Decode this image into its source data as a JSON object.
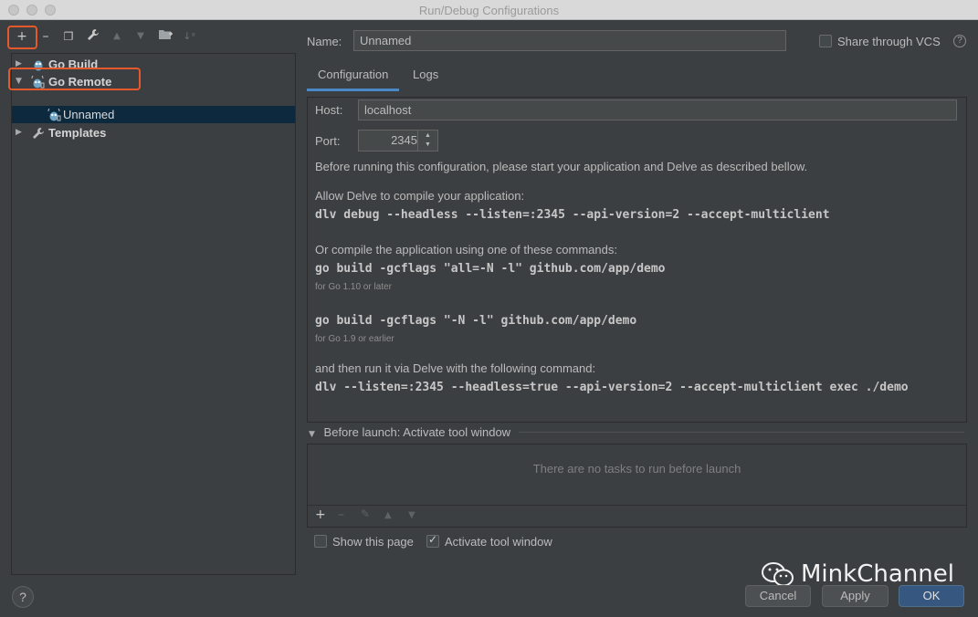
{
  "window": {
    "title": "Run/Debug Configurations"
  },
  "toolbar": {
    "icons": [
      "add-icon",
      "remove-icon",
      "copy-icon",
      "wrench-icon",
      "move-up-icon",
      "move-down-icon",
      "folder-add-icon",
      "sort-icon"
    ]
  },
  "tree": {
    "items": [
      {
        "label": "Go Build",
        "expanded": false,
        "icon": "gopher-icon"
      },
      {
        "label": "Go Remote",
        "expanded": true,
        "icon": "gopher-remote-icon"
      },
      {
        "label": "Unnamed",
        "selected": true,
        "icon": "gopher-remote-icon"
      },
      {
        "label": "Templates",
        "expanded": false,
        "icon": "wrench-icon"
      }
    ]
  },
  "name": {
    "label": "Name:",
    "value": "Unnamed"
  },
  "share": {
    "label": "Share through VCS",
    "checked": false
  },
  "tabs": [
    {
      "label": "Configuration",
      "active": true
    },
    {
      "label": "Logs",
      "active": false
    }
  ],
  "config": {
    "host_label": "Host:",
    "host_value": "localhost",
    "port_label": "Port:",
    "port_value": "2345",
    "intro": "Before running this configuration, please start your application and Delve as described bellow.",
    "allow_text": "Allow Delve to compile your application:",
    "cmd_dlv_debug": "dlv debug --headless --listen=:2345 --api-version=2 --accept-multiclient",
    "or_text": "Or compile the application using one of these commands:",
    "cmd_build_110": "go build -gcflags \"all=-N -l\" github.com/app/demo",
    "note_110": "for Go 1.10 or later",
    "cmd_build_19": "go build -gcflags \"-N -l\" github.com/app/demo",
    "note_19": "for Go 1.9 or earlier",
    "then_text": "and then run it via Delve with the following command:",
    "cmd_dlv_exec": "dlv --listen=:2345 --headless=true --api-version=2 --accept-multiclient exec ./demo"
  },
  "before_launch": {
    "title": "Before launch: Activate tool window",
    "empty_text": "There are no tasks to run before launch"
  },
  "options": {
    "show_page": {
      "label": "Show this page",
      "checked": false
    },
    "activate_tool": {
      "label": "Activate tool window",
      "checked": true
    }
  },
  "buttons": {
    "cancel": "Cancel",
    "apply": "Apply",
    "ok": "OK",
    "help": "?"
  },
  "watermark": {
    "text": "MinkChannel"
  },
  "colors": {
    "accent": "#4a88c7",
    "highlight": "#e4582b",
    "selection": "#0d293e",
    "primary_button": "#365880"
  }
}
